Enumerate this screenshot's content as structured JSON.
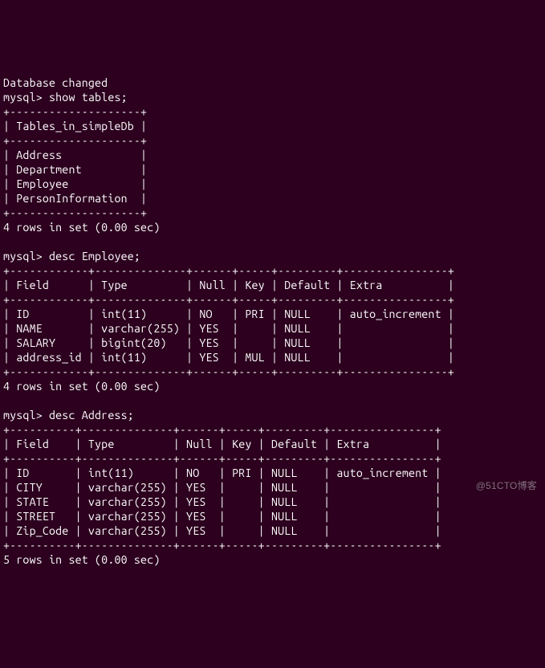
{
  "lines": {
    "db_changed": "Database changed",
    "prompt1": "mysql> show tables;",
    "t_border": "+--------------------+",
    "t_header": "| Tables_in_simpleDb |",
    "t_row1": "| Address            |",
    "t_row2": "| Department         |",
    "t_row3": "| Employee           |",
    "t_row4": "| PersonInformation  |",
    "t_result": "4 rows in set (0.00 sec)",
    "blank": "",
    "prompt2": "mysql> desc Employee;",
    "e_border": "+------------+--------------+------+-----+---------+----------------+",
    "e_header": "| Field      | Type         | Null | Key | Default | Extra          |",
    "e_row1": "| ID         | int(11)      | NO   | PRI | NULL    | auto_increment |",
    "e_row2": "| NAME       | varchar(255) | YES  |     | NULL    |                |",
    "e_row3": "| SALARY     | bigint(20)   | YES  |     | NULL    |                |",
    "e_row4": "| address_id | int(11)      | YES  | MUL | NULL    |                |",
    "e_result": "4 rows in set (0.00 sec)",
    "prompt3": "mysql> desc Address;",
    "a_border": "+----------+--------------+------+-----+---------+----------------+",
    "a_header": "| Field    | Type         | Null | Key | Default | Extra          |",
    "a_row1": "| ID       | int(11)      | NO   | PRI | NULL    | auto_increment |",
    "a_row2": "| CITY     | varchar(255) | YES  |     | NULL    |                |",
    "a_row3": "| STATE    | varchar(255) | YES  |     | NULL    |                |",
    "a_row4": "| STREET   | varchar(255) | YES  |     | NULL    |                |",
    "a_row5": "| Zip_Code | varchar(255) | YES  |     | NULL    |                |",
    "a_result": "5 rows in set (0.00 sec)"
  },
  "watermark": "@51CTO博客",
  "chart_data": {
    "type": "table",
    "tables_listing": {
      "header": "Tables_in_simpleDb",
      "rows": [
        "Address",
        "Department",
        "Employee",
        "PersonInformation"
      ],
      "row_count": 4,
      "elapsed_sec": 0.0
    },
    "employee_desc": {
      "columns": [
        "Field",
        "Type",
        "Null",
        "Key",
        "Default",
        "Extra"
      ],
      "rows": [
        [
          "ID",
          "int(11)",
          "NO",
          "PRI",
          "NULL",
          "auto_increment"
        ],
        [
          "NAME",
          "varchar(255)",
          "YES",
          "",
          "NULL",
          ""
        ],
        [
          "SALARY",
          "bigint(20)",
          "YES",
          "",
          "NULL",
          ""
        ],
        [
          "address_id",
          "int(11)",
          "YES",
          "MUL",
          "NULL",
          ""
        ]
      ],
      "row_count": 4,
      "elapsed_sec": 0.0
    },
    "address_desc": {
      "columns": [
        "Field",
        "Type",
        "Null",
        "Key",
        "Default",
        "Extra"
      ],
      "rows": [
        [
          "ID",
          "int(11)",
          "NO",
          "PRI",
          "NULL",
          "auto_increment"
        ],
        [
          "CITY",
          "varchar(255)",
          "YES",
          "",
          "NULL",
          ""
        ],
        [
          "STATE",
          "varchar(255)",
          "YES",
          "",
          "NULL",
          ""
        ],
        [
          "STREET",
          "varchar(255)",
          "YES",
          "",
          "NULL",
          ""
        ],
        [
          "Zip_Code",
          "varchar(255)",
          "YES",
          "",
          "NULL",
          ""
        ]
      ],
      "row_count": 5,
      "elapsed_sec": 0.0
    }
  }
}
